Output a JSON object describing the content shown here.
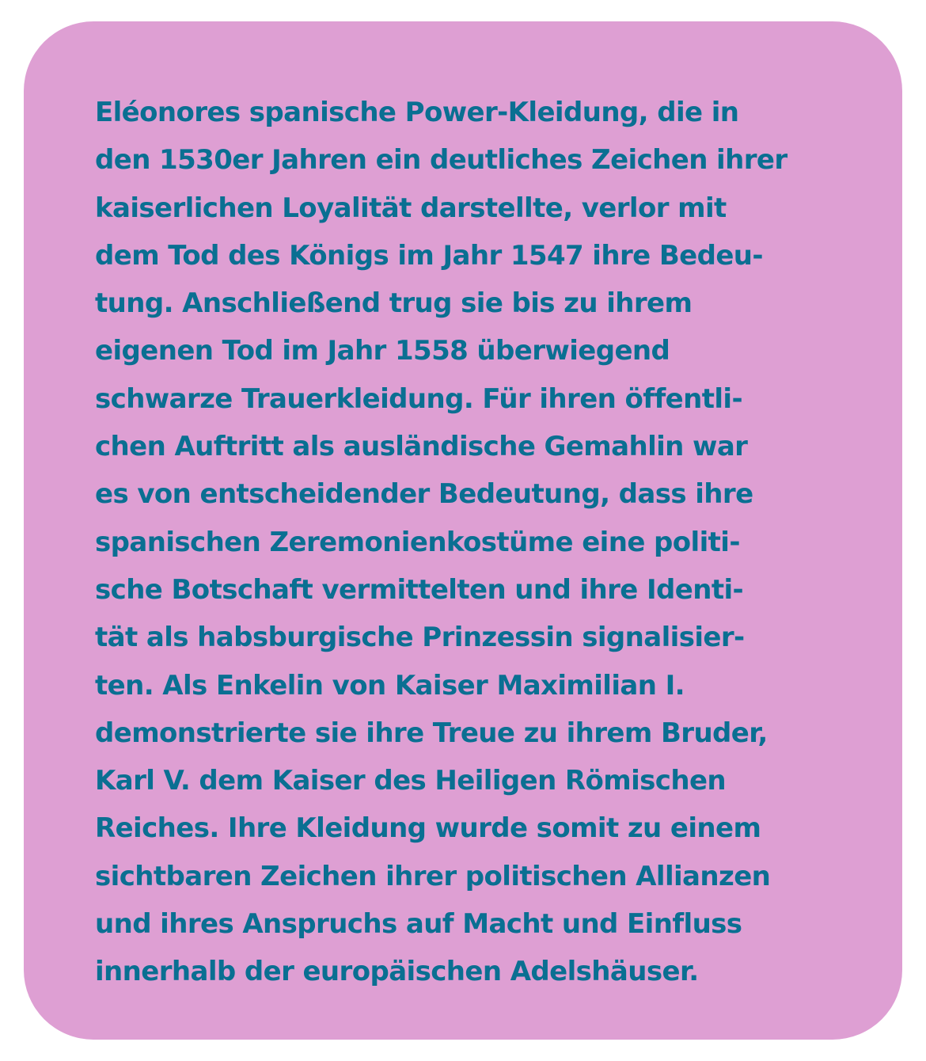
{
  "colors": {
    "page_background": "#ffffff",
    "card_background": "#de9fd3",
    "text": "#0a6f92"
  },
  "text_lines": [
    "Eléonores spanische Power-Kleidung, die in",
    "den 1530er Jahren ein deutliches Zeichen ihrer",
    "kaiserlichen Loyalität darstellte, verlor mit",
    "dem Tod des Königs im Jahr 1547 ihre Bedeu-",
    "tung. Anschließend trug sie bis zu ihrem",
    "eigenen Tod im Jahr 1558 überwiegend",
    "schwarze Trauerkleidung. Für ihren öffentli-",
    "chen Auftritt als ausländische Gemahlin war",
    "es von entscheidender Bedeutung, dass ihre",
    "spanischen Zeremonienkostüme eine politi-",
    "sche Botschaft vermittelten und ihre Identi-",
    "tät als habsburgische Prinzessin signalisier-",
    "ten. Als Enkelin von Kaiser Maximilian I.",
    "demonstrierte sie ihre Treue zu ihrem Bruder,",
    "Karl V. dem Kaiser des Heiligen Römischen",
    "Reiches. Ihre Kleidung wurde somit zu einem",
    "sichtbaren Zeichen ihrer politischen Allianzen",
    "und ihres Anspruchs auf Macht und Einfluss",
    "innerhalb der europäischen Adelshäuser."
  ]
}
